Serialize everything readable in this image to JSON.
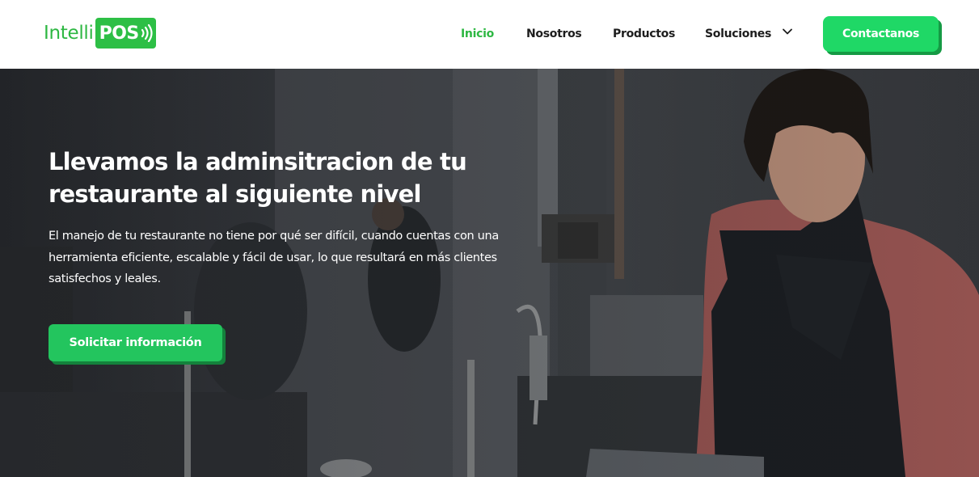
{
  "header": {
    "logo": {
      "part1": "Intelli",
      "part2": "POS"
    },
    "nav": [
      {
        "label": "Inicio",
        "active": true
      },
      {
        "label": "Nosotros",
        "active": false
      },
      {
        "label": "Productos",
        "active": false
      },
      {
        "label": "Soluciones",
        "active": false,
        "has_dropdown": true
      }
    ],
    "contact_label": "Contactanos"
  },
  "hero": {
    "title_line1": "Llevamos la adminsitracion de tu",
    "title_line2": "restaurante al siguiente nivel",
    "text_line1": "El manejo de tu restaurante no tiene por qué ser difícil, cuando cuentas con una",
    "text_line2": "herramienta eficiente, escalable y fácil de usar, lo que resultará en más clientes",
    "text_line3": "satisfechos y leales.",
    "cta_label": "Solicitar información",
    "background_image": "restaurant-kitchen-photo"
  },
  "colors": {
    "brand_green": "#2db742",
    "button_green": "#1fd866",
    "button_shadow": "#159a44",
    "nav_text": "#1d1d1d"
  },
  "icons": {
    "logo_waves": "signal-waves-icon",
    "dropdown": "chevron-down-icon"
  }
}
